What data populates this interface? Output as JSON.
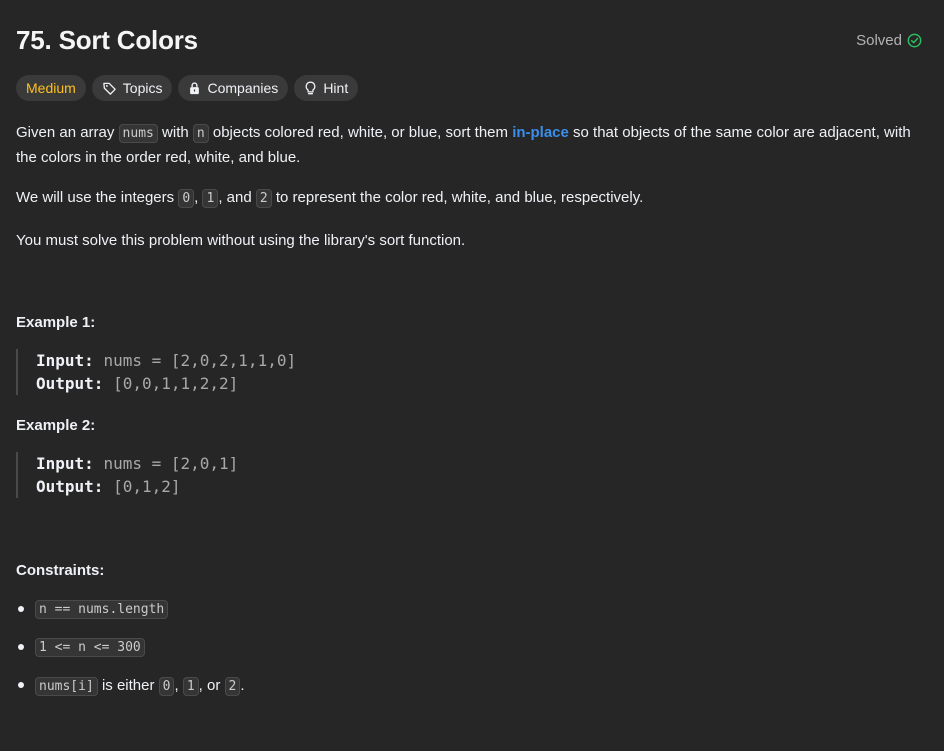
{
  "problem": {
    "title": "75. Sort Colors",
    "solved_label": "Solved",
    "colors": {
      "medium": "#ffc01e",
      "solved_check": "#2cbb5d",
      "link": "#3b8eea"
    }
  },
  "tags": [
    {
      "label": "Medium"
    },
    {
      "label": "Topics",
      "icon": "tag-icon"
    },
    {
      "label": "Companies",
      "icon": "lock-icon"
    },
    {
      "label": "Hint",
      "icon": "lightbulb-icon"
    }
  ],
  "description": {
    "p1": {
      "t1": "Given an array ",
      "code_nums": "nums",
      "t2": " with ",
      "code_n": "n",
      "t3": " objects colored red, white, or blue, sort them ",
      "link": "in-place",
      "t4": " so that objects of the same color are adjacent, with the colors in the order red, white, and blue."
    },
    "p2": {
      "t1": "We will use the integers ",
      "c0": "0",
      "t2": ", ",
      "c1": "1",
      "t3": ", and ",
      "c2": "2",
      "t4": " to represent the color red, white, and blue, respectively."
    },
    "p3": "You must solve this problem without using the library's sort function."
  },
  "examples": [
    {
      "heading": "Example 1:",
      "input_label": "Input:",
      "input_value": "nums = [2,0,2,1,1,0]",
      "output_label": "Output:",
      "output_value": "[0,0,1,1,2,2]"
    },
    {
      "heading": "Example 2:",
      "input_label": "Input:",
      "input_value": "nums = [2,0,1]",
      "output_label": "Output:",
      "output_value": "[0,1,2]"
    }
  ],
  "constraints": {
    "heading": "Constraints:",
    "items": [
      {
        "code": "n == nums.length"
      },
      {
        "code": "1 <= n <= 300"
      },
      {
        "code": "nums[i]",
        "t1": " is either ",
        "c0": "0",
        "t2": ", ",
        "c1": "1",
        "t3": ", or ",
        "c2": "2",
        "t4": "."
      }
    ]
  }
}
